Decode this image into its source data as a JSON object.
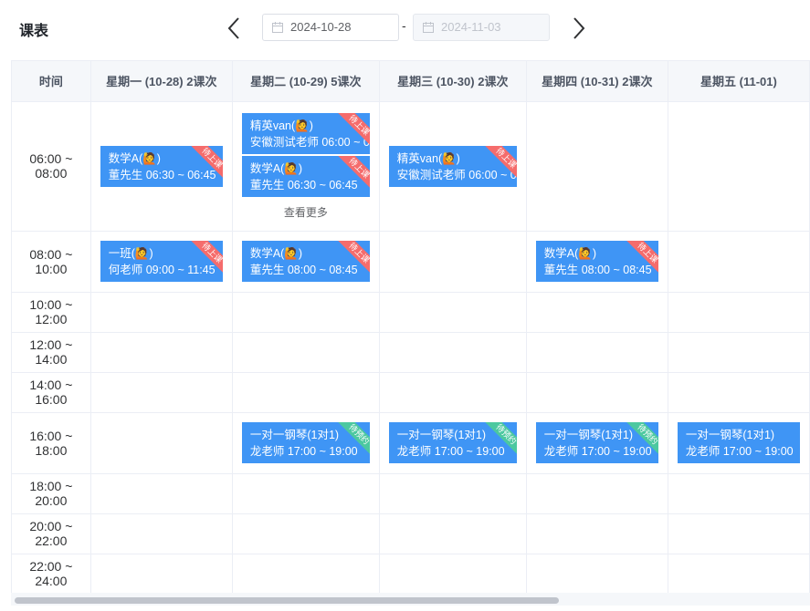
{
  "header": {
    "title": "课表",
    "start_date": "2024-10-28",
    "end_date": "2024-11-03",
    "separator": "-",
    "prev_icon": "chevron-left-icon",
    "next_icon": "chevron-right-icon",
    "calendar_icon": "calendar-icon"
  },
  "colors": {
    "event_bg": "#3f95f5",
    "ribbon_pending_class": "#f56c6c",
    "ribbon_pending_booking": "#4cc8a0",
    "header_bg": "#f5f7fa"
  },
  "columns": [
    "时间",
    "星期一 (10-28) 2课次",
    "星期二 (10-29) 5课次",
    "星期三 (10-30) 2课次",
    "星期四 (10-31) 2课次",
    "星期五 (11-01)"
  ],
  "more_label": "查看更多",
  "rows": [
    {
      "time": "06:00 ~ 08:00",
      "cells": [
        [
          {
            "title": "数学A(🙋)",
            "line2": "董先生 06:30 ~ 06:45",
            "status": "待上课",
            "status_type": "red"
          }
        ],
        [
          {
            "title": "精英van(🙋)",
            "line2": "安徽测试老师 06:00 ~ 0",
            "status": "待上课",
            "status_type": "red"
          },
          {
            "title": "数学A(🙋)",
            "line2": "董先生 06:30 ~ 06:45",
            "status": "待上课",
            "status_type": "red"
          }
        ],
        [
          {
            "title": "精英van(🙋)",
            "line2": "安徽测试老师 06:00 ~ 0",
            "status": "待上课",
            "status_type": "red"
          }
        ],
        [],
        []
      ],
      "more": [
        false,
        true,
        false,
        false,
        false
      ]
    },
    {
      "time": "08:00 ~ 10:00",
      "cells": [
        [
          {
            "title": "一班(🙋)",
            "line2": "何老师 09:00 ~ 11:45",
            "status": "待上课",
            "status_type": "red"
          }
        ],
        [
          {
            "title": "数学A(🙋)",
            "line2": "董先生 08:00 ~ 08:45",
            "status": "待上课",
            "status_type": "red"
          }
        ],
        [],
        [
          {
            "title": "数学A(🙋)",
            "line2": "董先生 08:00 ~ 08:45",
            "status": "待上课",
            "status_type": "red"
          }
        ],
        []
      ]
    },
    {
      "time": "10:00 ~ 12:00",
      "cells": [
        [],
        [],
        [],
        [],
        []
      ]
    },
    {
      "time": "12:00 ~ 14:00",
      "cells": [
        [],
        [],
        [],
        [],
        []
      ]
    },
    {
      "time": "14:00 ~ 16:00",
      "cells": [
        [],
        [],
        [],
        [],
        []
      ]
    },
    {
      "time": "16:00 ~ 18:00",
      "cells": [
        [],
        [
          {
            "title": "一对一钢琴(1对1)",
            "line2": "龙老师 17:00 ~ 19:00",
            "status": "待预约",
            "status_type": "green"
          }
        ],
        [
          {
            "title": "一对一钢琴(1对1)",
            "line2": "龙老师 17:00 ~ 19:00",
            "status": "待预约",
            "status_type": "green"
          }
        ],
        [
          {
            "title": "一对一钢琴(1对1)",
            "line2": "龙老师 17:00 ~ 19:00",
            "status": "待预约",
            "status_type": "green"
          }
        ],
        [
          {
            "title": "一对一钢琴(1对1)",
            "line2": "龙老师 17:00 ~ 19:00",
            "status": "",
            "status_type": "none"
          }
        ]
      ]
    },
    {
      "time": "18:00 ~ 20:00",
      "cells": [
        [],
        [],
        [],
        [],
        []
      ]
    },
    {
      "time": "20:00 ~ 22:00",
      "cells": [
        [],
        [],
        [],
        [],
        []
      ]
    },
    {
      "time": "22:00 ~ 24:00",
      "cells": [
        [],
        [],
        [],
        [],
        []
      ]
    }
  ]
}
